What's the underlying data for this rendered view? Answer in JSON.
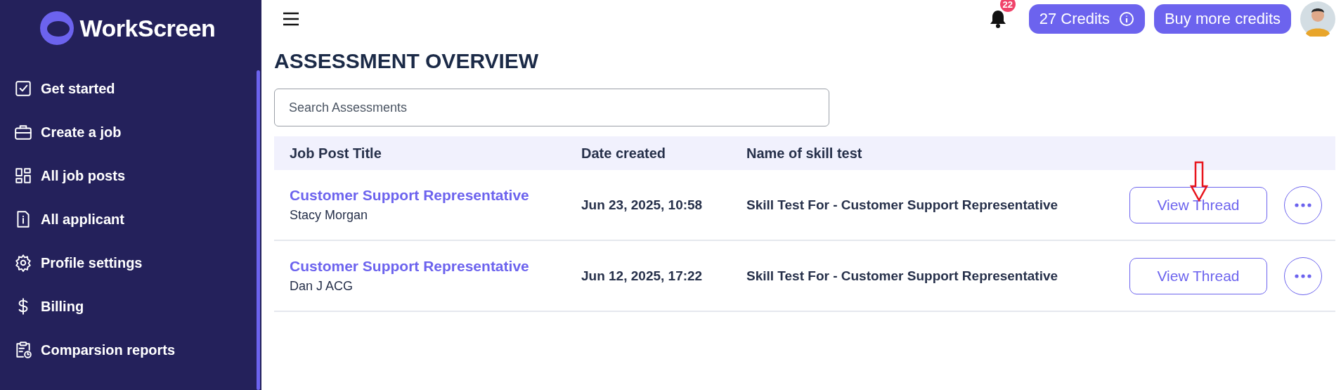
{
  "sidebar": {
    "logo": "WorkScreen",
    "items": [
      {
        "label": "Get started"
      },
      {
        "label": "Create a job"
      },
      {
        "label": "All job posts"
      },
      {
        "label": "All applicant"
      },
      {
        "label": "Profile settings"
      },
      {
        "label": "Billing"
      },
      {
        "label": "Comparsion reports"
      }
    ]
  },
  "top_bar": {
    "notification_count": "22",
    "credits": "27 Credits",
    "buy_button": "Buy more credits"
  },
  "page_title": "ASSESSMENT OVERVIEW",
  "search": {
    "placeholder": "Search Assessments"
  },
  "table": {
    "columns": [
      "Job Post Title",
      "Date created",
      "Name of skill test"
    ],
    "rows": [
      {
        "title": "Customer Support Representative",
        "candidate": "Stacy Morgan",
        "date": "Jun 23, 2025, 10:58",
        "skill_test": "Skill Test For - Customer Support Representative",
        "action": "View Thread",
        "annotated": true
      },
      {
        "title": "Customer Support Representative",
        "candidate": "Dan J ACG",
        "date": "Jun 12, 2025, 17:22",
        "skill_test": "Skill Test For - Customer Support Representative",
        "action": "View Thread",
        "annotated": false
      }
    ]
  }
}
